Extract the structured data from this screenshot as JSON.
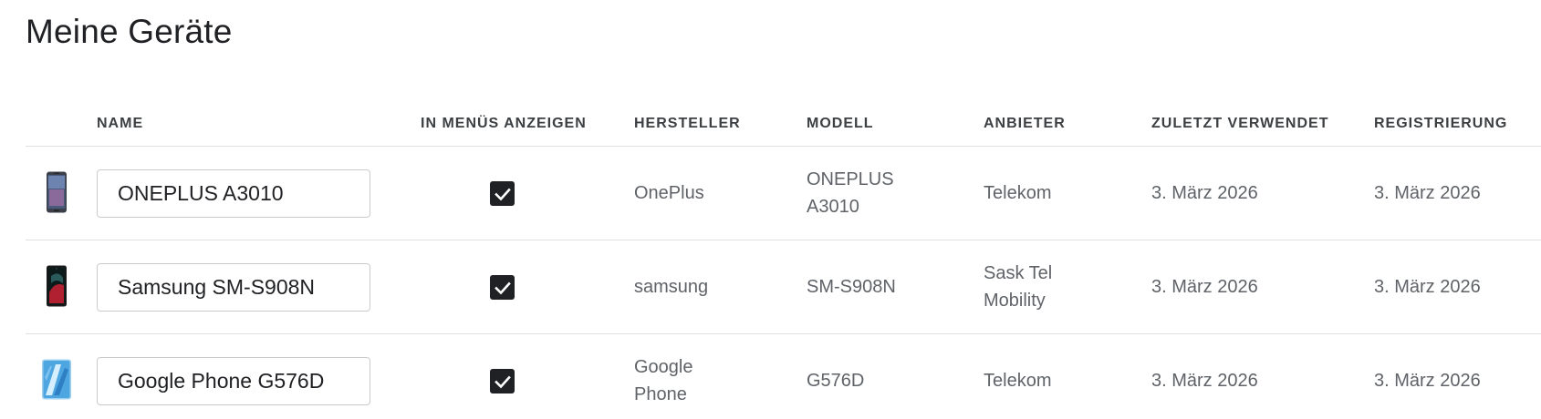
{
  "page": {
    "title": "Meine Geräte"
  },
  "table": {
    "headers": {
      "name": "NAME",
      "show_in_menus": "IN MENÜS ANZEIGEN",
      "manufacturer": "HERSTELLER",
      "model": "MODELL",
      "carrier": "ANBIETER",
      "last_used": "ZULETZT VERWENDET",
      "registration": "REGISTRIERUNG"
    },
    "rows": [
      {
        "device_icon": "oneplus-phone-icon",
        "name": "ONEPLUS A3010",
        "show_in_menus": true,
        "manufacturer": "OnePlus",
        "model_line1": "ONEPLUS",
        "model_line2": "A3010",
        "carrier_line1": "Telekom",
        "carrier_line2": "",
        "last_used": "3. März 2026",
        "registration": "3. März 2026"
      },
      {
        "device_icon": "samsung-phone-icon",
        "name": "Samsung SM-S908N",
        "show_in_menus": true,
        "manufacturer": "samsung",
        "model_line1": "SM-S908N",
        "model_line2": "",
        "carrier_line1": "Sask Tel",
        "carrier_line2": "Mobility",
        "last_used": "3. März 2026",
        "registration": "3. März 2026"
      },
      {
        "device_icon": "google-phone-icon",
        "name": "Google Phone G576D",
        "show_in_menus": true,
        "manufacturer_line1": "Google",
        "manufacturer_line2": "Phone",
        "model_line1": "G576D",
        "model_line2": "",
        "carrier_line1": "Telekom",
        "carrier_line2": "",
        "last_used": "3. März 2026",
        "registration": "3. März 2026"
      }
    ]
  },
  "colors": {
    "checkbox_fill": "#202124",
    "text_secondary": "#5f6368",
    "divider": "#e0e0e0"
  }
}
